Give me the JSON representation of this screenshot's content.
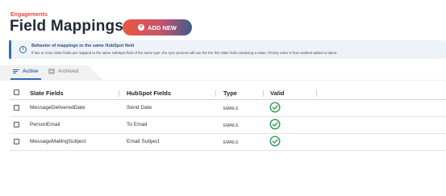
{
  "header": {
    "breadcrumb": "Engagements",
    "title": "Field Mappings",
    "add_button_label": "ADD NEW",
    "add_button_icon": "plus-circle-icon"
  },
  "info": {
    "icon": "info-icon",
    "title": "Behavior of mappings to the same HubSpot field",
    "text": "If two or more Slate fields are mapped to the same HubSpot field of the same type, the sync process will use the the first Slate field containing a value. Priority order is from earliest added to latest."
  },
  "tabs": [
    {
      "label": "Active",
      "icon": "list-icon",
      "active": true
    },
    {
      "label": "Archived",
      "icon": "archive-icon",
      "active": false
    }
  ],
  "table": {
    "columns": [
      "Slate Fields",
      "HubSpot Fields",
      "Type",
      "Valid"
    ],
    "rows": [
      {
        "slate": "MessageDeliveredDate",
        "hubspot": "Send Date",
        "type": "EMAILS",
        "valid": "check-circle-icon"
      },
      {
        "slate": "PersonEmail",
        "hubspot": "To Email",
        "type": "EMAILS",
        "valid": "check-circle-icon"
      },
      {
        "slate": "MessageMailingSubject",
        "hubspot": "Email Subject",
        "type": "EMAILS",
        "valid": "check-circle-icon"
      }
    ]
  },
  "colors": {
    "accent_red": "#e8483c",
    "accent_blue": "#2f6db3",
    "valid_green": "#2e9e4f",
    "title": "#1f2a37"
  }
}
